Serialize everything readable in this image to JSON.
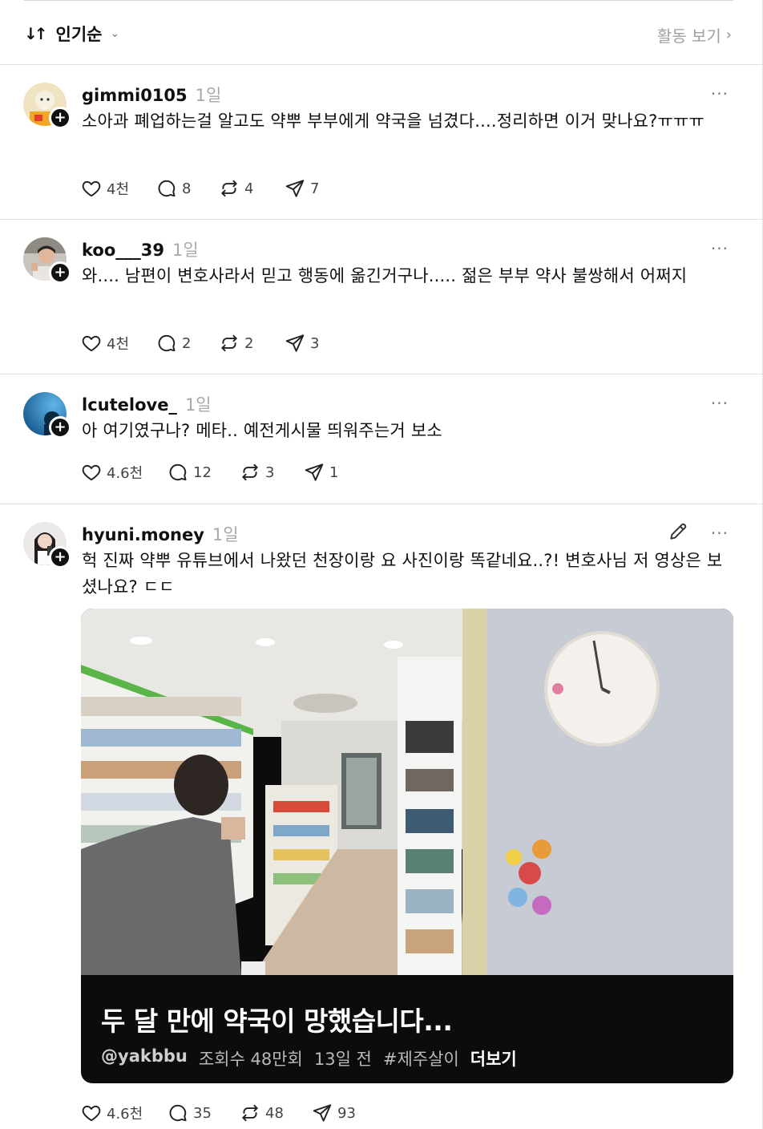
{
  "header": {
    "sort_icon": "↓↑",
    "sort_label": "인기순",
    "sort_chevron": "⌄",
    "activity_label": "활동 보기",
    "activity_chevron": "›"
  },
  "posts": [
    {
      "username": "gimmi0105",
      "time": "1일",
      "text": "소아과 폐업하는걸 알고도 약뿌 부부에게 약국을 넘겼다....정리하면 이거 맞나요?ㅠㅠㅠ",
      "likes": "4천",
      "replies": "8",
      "reposts": "4",
      "shares": "7"
    },
    {
      "username": "koo___39",
      "time": "1일",
      "text": "와.... 남편이 변호사라서 믿고 행동에 옮긴거구나..... 젊은 부부 약사 불쌍해서 어쩌지",
      "likes": "4천",
      "replies": "2",
      "reposts": "2",
      "shares": "3"
    },
    {
      "username": "lcutelove_",
      "time": "1일",
      "text": "아 여기였구나? 메타.. 예전게시물 띄워주는거 보소",
      "likes": "4.6천",
      "replies": "12",
      "reposts": "3",
      "shares": "1"
    },
    {
      "username": "hyuni.money",
      "time": "1일",
      "text": "헉 진짜 약뿌 유튜브에서 나왔던 천장이랑 요 사진이랑 똑같네요..?! 변호사님 저 영상은 보셨나요? ㄷㄷ",
      "likes": "4.6천",
      "replies": "35",
      "reposts": "48",
      "shares": "93",
      "media": {
        "title": "두 달 만에 약국이 망했습니다...",
        "handle": "@yakbbu",
        "views": "조회수 48만회",
        "ago": "13일 전",
        "tag": "#제주살이",
        "more": "더보기"
      }
    }
  ],
  "plus": "+",
  "more_glyph": "···",
  "colors": {
    "muted": "#a8a8a8",
    "divider": "#e0e0e0",
    "text": "#101010"
  }
}
